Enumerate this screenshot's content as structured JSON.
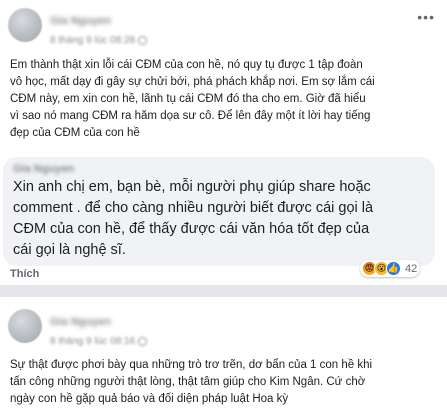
{
  "post1": {
    "author": "Gia Nguyen",
    "time": "8 tháng 9 lúc 08:28",
    "text": "Em thành thật xin lỗi cái CĐM của con hề, nó quy tụ được 1 tập đoàn\nvô học, mất dạy đi gây sự chửi bới, phá phách khắp nơi. Em sợ lắm cái\nCĐM này, em xin con hề, lãnh tụ cái CĐM đó tha cho em. Giờ đã hiểu\nvì sao nó mang CĐM ra hăm dọa sư cô. Để lên đây một ít lời hay tiếng\nđẹp của CĐM của con hề",
    "comment": {
      "author": "Gia Nguyen",
      "text": "Xin anh chị em, bạn bè, mỗi người phụ giúp share hoặc\ncomment . để cho càng nhiều người biết được cái gọi là\nCĐM của con hề, để thấy được cái văn hóa tốt đẹp của\ncái gọi là nghệ sĩ.",
      "like_label": "Thích",
      "reaction_count": "42"
    }
  },
  "post2": {
    "author": "Gia Nguyen",
    "time": "8 tháng 9 lúc 08:16",
    "text": "Sự thật được phơi bày qua những trò trơ trẽn, dơ bẩn của 1 con hề khi\ntấn công những người thật lòng, thật tâm giúp cho Kim Ngân. Cứ chờ\nngày con hề gặp quả báo và đối diện pháp luật Hoa kỳ"
  },
  "icons": {
    "more": "more-icon",
    "globe": "globe-icon",
    "reactions": [
      "angry-icon",
      "wow-icon",
      "like-icon"
    ]
  }
}
